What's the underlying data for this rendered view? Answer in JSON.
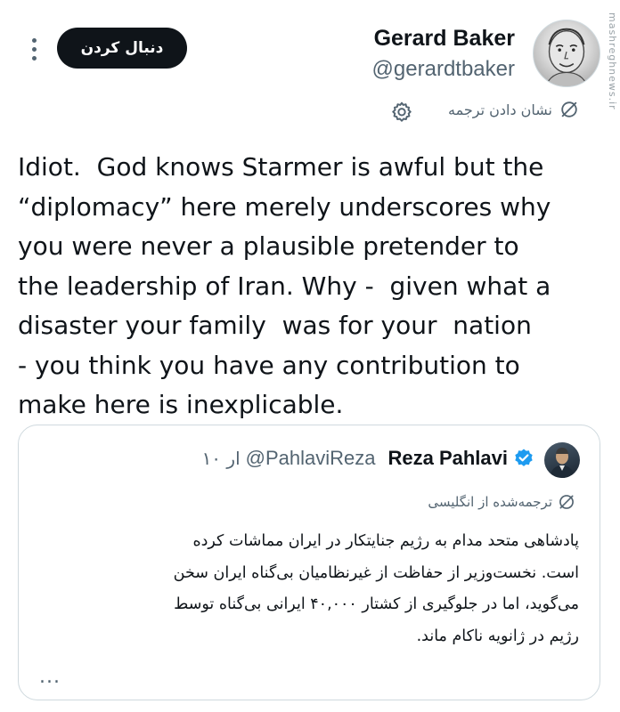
{
  "tweet": {
    "author": {
      "name": "Gerard Baker",
      "handle": "@gerardtbaker"
    },
    "follow_label": "دنبال کردن",
    "translate_label": "نشان دادن ترجمه",
    "watermark": "mashreghnews.ir",
    "text_lines": [
      "Idiot.  God knows Starmer is awful but the",
      "“diplomacy” here merely underscores why",
      "you were never a plausible pretender to",
      "the leadership of Iran. Why -  given what a",
      "disaster your family  was for your  nation",
      "- you think you have any contribution to",
      "make here is inexplicable."
    ]
  },
  "quoted": {
    "name": "Reza Pahlavi",
    "handle": "@PahlaviReza",
    "time": "۱۰ ار",
    "translated_label": "ترجمه‌شده از انگلیسی",
    "text_lines": [
      "پادشاهی متحد مدام به رژیم جنایتکار در ایران مماشات کرده",
      "است. نخست‌وزیر از حفاظت از غیرنظامیان بی‌گناه ایران سخن",
      "می‌گوید، اما در جلوگیری از کشتار ۴۰,۰۰۰ ایرانی بی‌گناه توسط",
      "رژیم در ژانویه ناکام ماند."
    ],
    "ellipsis": "..."
  },
  "colors": {
    "text": "#0f1419",
    "secondary": "#536471",
    "border": "#cfd9de",
    "verified": "#1d9bf0",
    "button_bg": "#0f1419"
  },
  "icons": [
    "more-dots-icon",
    "translate-icon",
    "gear-icon",
    "verified-badge-icon"
  ]
}
